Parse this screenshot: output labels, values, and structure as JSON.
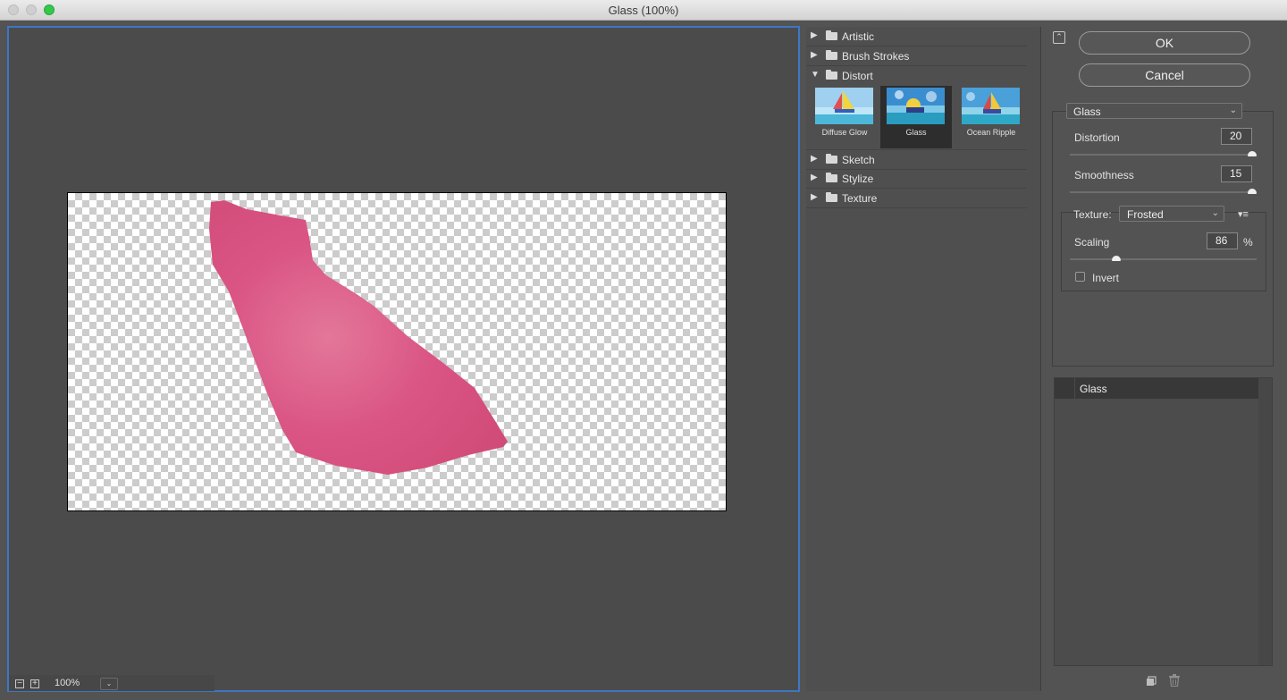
{
  "window": {
    "title": "Glass (100%)"
  },
  "preview": {
    "zoom": "100%",
    "zoom_out": "−",
    "zoom_in": "+",
    "zoom_dropdown": "⌄"
  },
  "gallery": {
    "folders": [
      {
        "label": "Artistic",
        "expanded": false,
        "arrow": "▶"
      },
      {
        "label": "Brush Strokes",
        "expanded": false,
        "arrow": "▶"
      },
      {
        "label": "Distort",
        "expanded": true,
        "arrow": "▼"
      },
      {
        "label": "Sketch",
        "expanded": false,
        "arrow": "▶"
      },
      {
        "label": "Stylize",
        "expanded": false,
        "arrow": "▶"
      },
      {
        "label": "Texture",
        "expanded": false,
        "arrow": "▶"
      }
    ],
    "thumbnails": [
      {
        "label": "Diffuse Glow",
        "selected": false
      },
      {
        "label": "Glass",
        "selected": true
      },
      {
        "label": "Ocean Ripple",
        "selected": false
      }
    ]
  },
  "actions": {
    "ok": "OK",
    "cancel": "Cancel",
    "collapse_icon": "⌃"
  },
  "settings": {
    "filter": "Glass",
    "chevron": "⌄",
    "distortion": {
      "label": "Distortion",
      "value": "20",
      "slider_fraction": 1.0
    },
    "smoothness": {
      "label": "Smoothness",
      "value": "15",
      "slider_fraction": 1.0
    },
    "texture": {
      "label": "Texture:",
      "value": "Frosted",
      "menu_icon": "▾≡"
    },
    "scaling": {
      "label": "Scaling",
      "value": "86",
      "unit": "%",
      "slider_fraction": 0.25
    },
    "invert": {
      "label": "Invert",
      "checked": false
    }
  },
  "layers": {
    "items": [
      {
        "name": "Glass"
      }
    ]
  },
  "colors": {
    "accent": "#3d77c4",
    "shape": "#d94f7e",
    "panel": "#535353"
  }
}
